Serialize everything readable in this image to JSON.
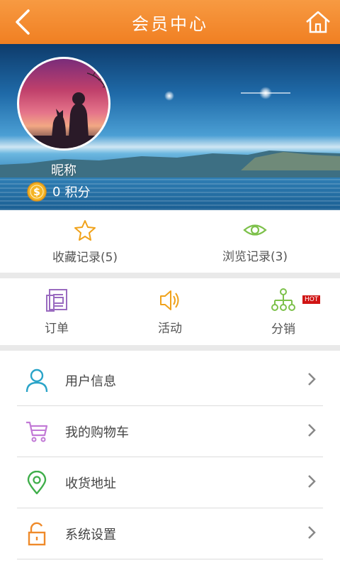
{
  "header": {
    "title": "会员中心",
    "back_icon": "back-arrow-icon",
    "home_icon": "home-icon"
  },
  "profile": {
    "nickname": "昵称",
    "points_value": "0",
    "points_unit": "积分"
  },
  "records": [
    {
      "label": "收藏记录(5)",
      "icon": "star-icon"
    },
    {
      "label": "浏览记录(3)",
      "icon": "eye-icon"
    }
  ],
  "features": [
    {
      "label": "订单",
      "icon": "order-icon"
    },
    {
      "label": "活动",
      "icon": "speaker-icon"
    },
    {
      "label": "分销",
      "icon": "network-icon",
      "badge": "HOT"
    }
  ],
  "menu": [
    {
      "label": "用户信息",
      "icon": "user-icon"
    },
    {
      "label": "我的购物车",
      "icon": "cart-icon"
    },
    {
      "label": "收货地址",
      "icon": "location-pin-icon"
    },
    {
      "label": "系统设置",
      "icon": "unlock-icon"
    }
  ],
  "colors": {
    "header": "#f28a2e",
    "accent_orange": "#f0a21a",
    "green": "#7dc14b",
    "purple": "#9a6bc0",
    "teal": "#2aa4c8"
  }
}
